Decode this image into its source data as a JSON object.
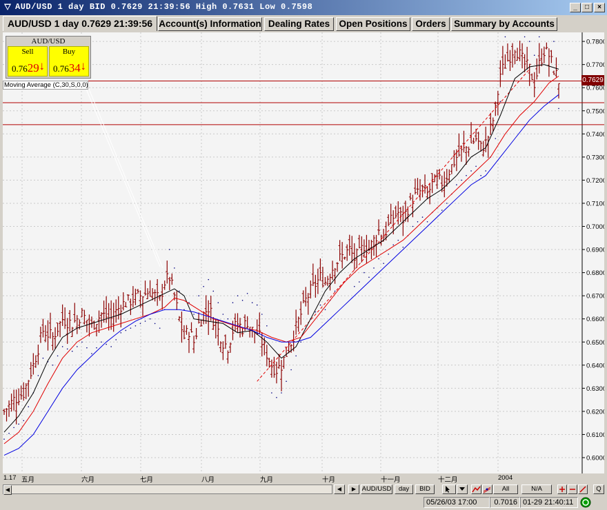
{
  "window": {
    "title": "AUD/USD 1 day BID 0.7629 21:39:56 High 0.7631 Low 0.7598",
    "minimize_label": "_",
    "maximize_label": "□",
    "close_label": "×"
  },
  "tabs": [
    {
      "label": "AUD/USD 1 day 0.7629 21:39:56"
    },
    {
      "label": "Account(s) Information"
    },
    {
      "label": "Dealing Rates"
    },
    {
      "label": "Open Positions"
    },
    {
      "label": "Orders"
    },
    {
      "label": "Summary by Accounts"
    }
  ],
  "quote_panel": {
    "title": "AUD/USD",
    "sell": {
      "label": "Sell",
      "prefix": "0.76",
      "big": "29",
      "arrow": "↓"
    },
    "buy": {
      "label": "Buy",
      "prefix": "0.76",
      "big": "34",
      "arrow": "↓"
    }
  },
  "indicator_label": "Moving Average (C,30,S,0,0)",
  "current_price_tag": "0.7629",
  "chart_data": {
    "type": "candlestick",
    "instrument": "AUD/USD",
    "timeframe": "1 day",
    "ylim": [
      0.595,
      0.785
    ],
    "y_ticks": [
      "0.7800",
      "0.7700",
      "0.7600",
      "0.7500",
      "0.7400",
      "0.7300",
      "0.7200",
      "0.7100",
      "0.7000",
      "0.6900",
      "0.6800",
      "0.6700",
      "0.6600",
      "0.6500",
      "0.6400",
      "0.6300",
      "0.6200",
      "0.6100",
      "0.6000"
    ],
    "x_ticks": [
      "1.17",
      "五月",
      "六月",
      "七月",
      "八月",
      "九月",
      "十月",
      "十一月",
      "十二月",
      "2004"
    ],
    "horizontal_levels": [
      0.7629,
      0.7535,
      0.744
    ],
    "close_path": [
      [
        0,
        0.62
      ],
      [
        4,
        0.625
      ],
      [
        8,
        0.628
      ],
      [
        12,
        0.64
      ],
      [
        16,
        0.655
      ],
      [
        20,
        0.652
      ],
      [
        24,
        0.66
      ],
      [
        28,
        0.658
      ],
      [
        32,
        0.662
      ],
      [
        36,
        0.657
      ],
      [
        40,
        0.662
      ],
      [
        44,
        0.66
      ],
      [
        48,
        0.666
      ],
      [
        52,
        0.668
      ],
      [
        56,
        0.67
      ],
      [
        60,
        0.672
      ],
      [
        64,
        0.668
      ],
      [
        66,
        0.676
      ],
      [
        68,
        0.678
      ],
      [
        70,
        0.67
      ],
      [
        72,
        0.66
      ],
      [
        74,
        0.652
      ],
      [
        76,
        0.655
      ],
      [
        78,
        0.65
      ],
      [
        80,
        0.658
      ],
      [
        82,
        0.662
      ],
      [
        84,
        0.665
      ],
      [
        86,
        0.66
      ],
      [
        88,
        0.655
      ],
      [
        90,
        0.65
      ],
      [
        92,
        0.648
      ],
      [
        94,
        0.655
      ],
      [
        96,
        0.658
      ],
      [
        98,
        0.656
      ],
      [
        100,
        0.659
      ],
      [
        102,
        0.655
      ],
      [
        104,
        0.654
      ],
      [
        106,
        0.65
      ],
      [
        108,
        0.645
      ],
      [
        110,
        0.64
      ],
      [
        112,
        0.638
      ],
      [
        114,
        0.64
      ],
      [
        116,
        0.645
      ],
      [
        118,
        0.65
      ],
      [
        120,
        0.656
      ],
      [
        122,
        0.662
      ],
      [
        124,
        0.668
      ],
      [
        126,
        0.672
      ],
      [
        128,
        0.675
      ],
      [
        130,
        0.678
      ],
      [
        132,
        0.676
      ],
      [
        134,
        0.68
      ],
      [
        136,
        0.684
      ],
      [
        138,
        0.686
      ],
      [
        140,
        0.688
      ],
      [
        142,
        0.69
      ],
      [
        144,
        0.686
      ],
      [
        146,
        0.688
      ],
      [
        148,
        0.692
      ],
      [
        150,
        0.69
      ],
      [
        152,
        0.694
      ],
      [
        154,
        0.698
      ],
      [
        156,
        0.696
      ],
      [
        158,
        0.7
      ],
      [
        160,
        0.704
      ],
      [
        162,
        0.706
      ],
      [
        164,
        0.703
      ],
      [
        166,
        0.708
      ],
      [
        168,
        0.712
      ],
      [
        170,
        0.714
      ],
      [
        172,
        0.716
      ],
      [
        174,
        0.714
      ],
      [
        176,
        0.718
      ],
      [
        178,
        0.72
      ],
      [
        180,
        0.719
      ],
      [
        182,
        0.722
      ],
      [
        184,
        0.726
      ],
      [
        186,
        0.73
      ],
      [
        188,
        0.732
      ],
      [
        190,
        0.734
      ],
      [
        192,
        0.736
      ],
      [
        194,
        0.738
      ],
      [
        196,
        0.734
      ],
      [
        198,
        0.736
      ],
      [
        200,
        0.742
      ],
      [
        202,
        0.75
      ],
      [
        204,
        0.766
      ],
      [
        206,
        0.77
      ],
      [
        208,
        0.774
      ],
      [
        210,
        0.778
      ],
      [
        212,
        0.774
      ],
      [
        214,
        0.77
      ],
      [
        216,
        0.768
      ],
      [
        218,
        0.762
      ],
      [
        220,
        0.77
      ],
      [
        222,
        0.776
      ],
      [
        224,
        0.774
      ],
      [
        226,
        0.768
      ],
      [
        228,
        0.763
      ]
    ],
    "series": [
      {
        "color": "#000000",
        "values": [
          [
            0,
            0.611
          ],
          [
            6,
            0.618
          ],
          [
            12,
            0.628
          ],
          [
            18,
            0.642
          ],
          [
            24,
            0.652
          ],
          [
            30,
            0.656
          ],
          [
            36,
            0.658
          ],
          [
            42,
            0.66
          ],
          [
            48,
            0.662
          ],
          [
            54,
            0.665
          ],
          [
            60,
            0.668
          ],
          [
            66,
            0.671
          ],
          [
            70,
            0.673
          ],
          [
            74,
            0.67
          ],
          [
            78,
            0.66
          ],
          [
            84,
            0.659
          ],
          [
            90,
            0.658
          ],
          [
            96,
            0.654
          ],
          [
            102,
            0.655
          ],
          [
            108,
            0.65
          ],
          [
            114,
            0.643
          ],
          [
            120,
            0.648
          ],
          [
            126,
            0.66
          ],
          [
            132,
            0.672
          ],
          [
            138,
            0.68
          ],
          [
            144,
            0.686
          ],
          [
            150,
            0.69
          ],
          [
            156,
            0.694
          ],
          [
            162,
            0.7
          ],
          [
            168,
            0.706
          ],
          [
            174,
            0.712
          ],
          [
            180,
            0.716
          ],
          [
            186,
            0.722
          ],
          [
            192,
            0.73
          ],
          [
            198,
            0.734
          ],
          [
            204,
            0.748
          ],
          [
            210,
            0.764
          ],
          [
            216,
            0.769
          ],
          [
            222,
            0.77
          ],
          [
            228,
            0.768
          ]
        ]
      },
      {
        "color": "#e00000",
        "values": [
          [
            0,
            0.606
          ],
          [
            6,
            0.611
          ],
          [
            12,
            0.62
          ],
          [
            18,
            0.632
          ],
          [
            24,
            0.643
          ],
          [
            30,
            0.65
          ],
          [
            36,
            0.654
          ],
          [
            42,
            0.656
          ],
          [
            48,
            0.658
          ],
          [
            54,
            0.66
          ],
          [
            60,
            0.662
          ],
          [
            66,
            0.665
          ],
          [
            70,
            0.669
          ],
          [
            74,
            0.668
          ],
          [
            80,
            0.664
          ],
          [
            86,
            0.66
          ],
          [
            92,
            0.658
          ],
          [
            98,
            0.656
          ],
          [
            104,
            0.655
          ],
          [
            110,
            0.652
          ],
          [
            116,
            0.65
          ],
          [
            122,
            0.652
          ],
          [
            128,
            0.66
          ],
          [
            134,
            0.668
          ],
          [
            140,
            0.676
          ],
          [
            146,
            0.682
          ],
          [
            152,
            0.686
          ],
          [
            158,
            0.69
          ],
          [
            164,
            0.694
          ],
          [
            170,
            0.7
          ],
          [
            176,
            0.706
          ],
          [
            182,
            0.712
          ],
          [
            188,
            0.718
          ],
          [
            194,
            0.724
          ],
          [
            200,
            0.73
          ],
          [
            206,
            0.74
          ],
          [
            212,
            0.748
          ],
          [
            218,
            0.754
          ],
          [
            224,
            0.762
          ],
          [
            228,
            0.765
          ]
        ]
      },
      {
        "color": "#0000e0",
        "values": [
          [
            0,
            0.601
          ],
          [
            6,
            0.604
          ],
          [
            12,
            0.61
          ],
          [
            18,
            0.62
          ],
          [
            24,
            0.63
          ],
          [
            30,
            0.638
          ],
          [
            36,
            0.644
          ],
          [
            42,
            0.65
          ],
          [
            48,
            0.655
          ],
          [
            54,
            0.659
          ],
          [
            60,
            0.662
          ],
          [
            66,
            0.664
          ],
          [
            72,
            0.664
          ],
          [
            78,
            0.663
          ],
          [
            84,
            0.661
          ],
          [
            90,
            0.659
          ],
          [
            96,
            0.657
          ],
          [
            102,
            0.655
          ],
          [
            108,
            0.652
          ],
          [
            114,
            0.65
          ],
          [
            120,
            0.65
          ],
          [
            126,
            0.652
          ],
          [
            132,
            0.658
          ],
          [
            138,
            0.664
          ],
          [
            144,
            0.67
          ],
          [
            150,
            0.676
          ],
          [
            156,
            0.682
          ],
          [
            162,
            0.688
          ],
          [
            168,
            0.694
          ],
          [
            174,
            0.7
          ],
          [
            180,
            0.706
          ],
          [
            186,
            0.712
          ],
          [
            192,
            0.718
          ],
          [
            198,
            0.722
          ],
          [
            204,
            0.73
          ],
          [
            210,
            0.738
          ],
          [
            216,
            0.746
          ],
          [
            222,
            0.752
          ],
          [
            228,
            0.757
          ]
        ]
      }
    ]
  },
  "controls": {
    "prev": "◀",
    "next": "▶",
    "instrument": "AUD/USD",
    "period": "day",
    "side": "BID",
    "all": "All",
    "na": "N/A",
    "btn_q": "Q"
  },
  "status": {
    "datetime": "05/26/03 17:00",
    "value": "0.7016",
    "clock": "01-29 21:40:11"
  }
}
